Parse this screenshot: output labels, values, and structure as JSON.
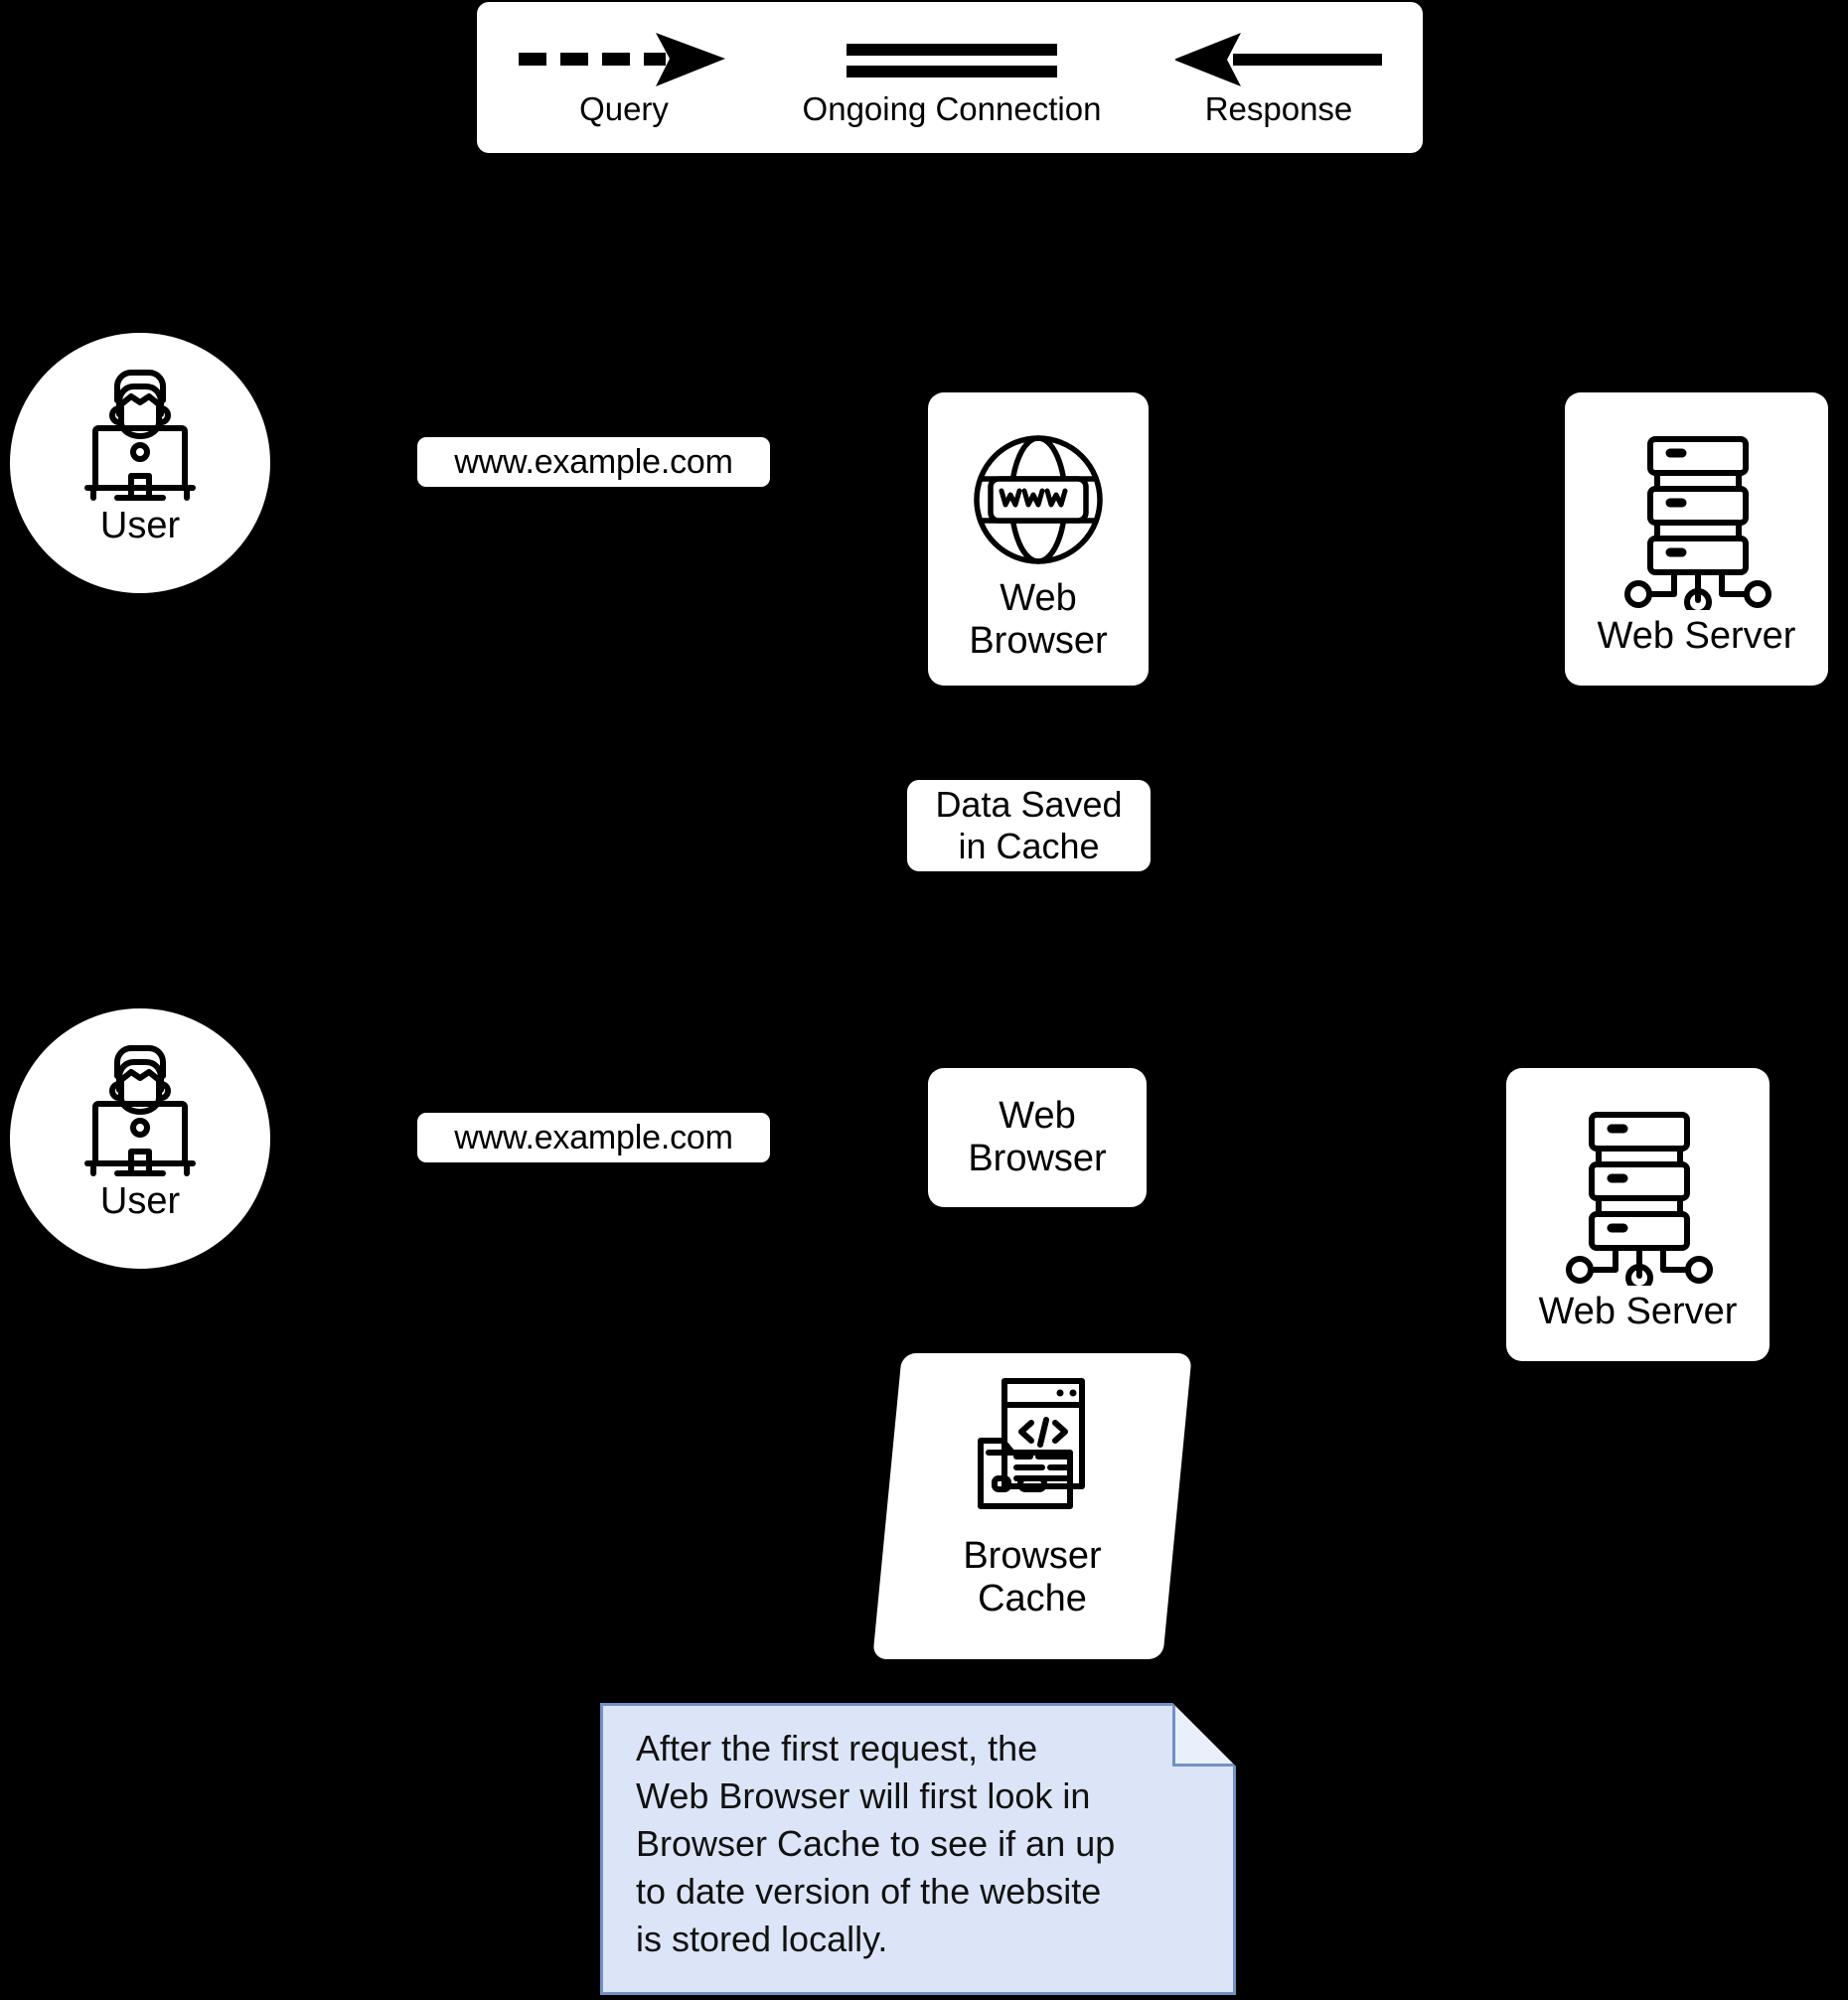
{
  "legend": {
    "items": [
      {
        "id": "query",
        "label": "Query",
        "glyph": "dashed-arrow-right-icon"
      },
      {
        "id": "ongoing",
        "label": "Ongoing Connection",
        "glyph": "double-line-icon"
      },
      {
        "id": "response",
        "label": "Response",
        "glyph": "solid-arrow-left-icon"
      }
    ]
  },
  "colors": {
    "background": "#000000",
    "node_fill": "#ffffff",
    "stroke": "#000000",
    "note_fill": "#dbe5f7",
    "note_border": "#7391c6",
    "note_fold_fill": "#eaf0fb"
  },
  "row1": {
    "user": {
      "label": "User",
      "icon": "user-at-computer-icon"
    },
    "url": {
      "label": "www.example.com"
    },
    "browser": {
      "label": "Web\nBrowser",
      "icon": "globe-www-icon"
    },
    "server": {
      "label": "Web Server",
      "icon": "server-rack-icon"
    },
    "cache_note": {
      "label": "Data Saved\nin Cache"
    }
  },
  "row2": {
    "user": {
      "label": "User",
      "icon": "user-at-computer-icon"
    },
    "url": {
      "label": "www.example.com"
    },
    "browser": {
      "label": "Web\nBrowser"
    },
    "server": {
      "label": "Web Server",
      "icon": "server-rack-icon"
    },
    "cache": {
      "label": "Browser\nCache",
      "icon": "code-window-folder-icon"
    }
  },
  "note": {
    "text": "After the first request, the\nWeb Browser will first look in\nBrowser Cache to see if an up\nto date version of the website\nis stored locally."
  }
}
